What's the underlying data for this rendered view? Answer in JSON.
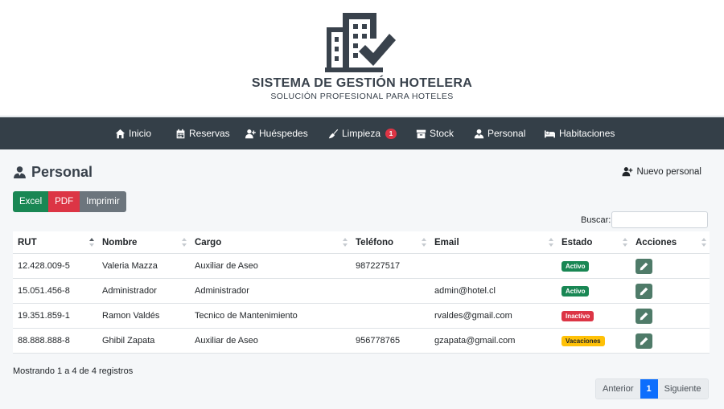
{
  "brand": {
    "title": "SISTEMA DE GESTIÓN HOTELERA",
    "subtitle": "SOLUCIÓN PROFESIONAL PARA HOTELES",
    "logo_icon": "hotel-building-check-icon"
  },
  "nav": {
    "items": [
      {
        "label": "Inicio",
        "icon": "home-icon"
      },
      {
        "label": "Reservas",
        "icon": "calendar-icon"
      },
      {
        "label": "Huéspedes",
        "icon": "user-plus-icon"
      },
      {
        "label": "Limpieza",
        "icon": "broom-icon",
        "badge": "1"
      },
      {
        "label": "Stock",
        "icon": "box-icon"
      },
      {
        "label": "Personal",
        "icon": "user-tie-icon"
      },
      {
        "label": "Habitaciones",
        "icon": "bed-icon"
      }
    ]
  },
  "page": {
    "title": "Personal",
    "new_button": "Nuevo personal"
  },
  "export": {
    "excel": "Excel",
    "pdf": "PDF",
    "print": "Imprimir"
  },
  "search": {
    "label": "Buscar:",
    "value": ""
  },
  "table": {
    "headers": [
      "RUT",
      "Nombre",
      "Cargo",
      "Teléfono",
      "Email",
      "Estado",
      "Acciones"
    ],
    "sorted_column": "RUT",
    "sort_direction": "asc",
    "rows": [
      {
        "rut": "12.428.009-5",
        "nombre": "Valeria Mazza",
        "cargo": "Auxiliar de Aseo",
        "telefono": "987227517",
        "email": "",
        "estado": "Activo"
      },
      {
        "rut": "15.051.456-8",
        "nombre": "Administrador",
        "cargo": "Administrador",
        "telefono": "",
        "email": "admin@hotel.cl",
        "estado": "Activo"
      },
      {
        "rut": "19.351.859-1",
        "nombre": "Ramon Valdés",
        "cargo": "Tecnico de Mantenimiento",
        "telefono": "",
        "email": "rvaldes@gmail.com",
        "estado": "Inactivo"
      },
      {
        "rut": "88.888.888-8",
        "nombre": "Ghibil Zapata",
        "cargo": "Auxiliar de Aseo",
        "telefono": "956778765",
        "email": "gzapata@gmail.com",
        "estado": "Vacaciones"
      }
    ]
  },
  "status_colors": {
    "Activo": "#198754",
    "Inactivo": "#dc3545",
    "Vacaciones": "#ffc107"
  },
  "footer": {
    "info": "Mostrando 1 a 4 de 4 registros",
    "prev": "Anterior",
    "current_page": "1",
    "next": "Siguiente"
  }
}
